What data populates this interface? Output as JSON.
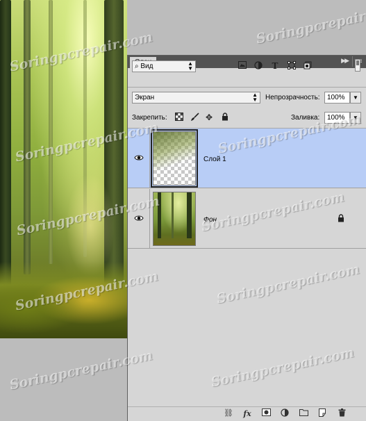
{
  "watermark": "Soringpcrepair.com",
  "panel": {
    "tab_label": "Слои",
    "collapse_icon": "double-chevron-right-icon",
    "menu_icon": "panel-menu-icon"
  },
  "filter": {
    "kind_label": "Вид",
    "icons": [
      "image-filter-icon",
      "adjustment-filter-icon",
      "type-filter-icon",
      "shape-filter-icon",
      "smart-object-filter-icon"
    ]
  },
  "blend": {
    "mode": "Экран",
    "opacity_label": "Непрозрачность:",
    "opacity_value": "100%",
    "lock_label": "Закрепить:",
    "fill_label": "Заливка:",
    "fill_value": "100%"
  },
  "layers": [
    {
      "name": "Слой 1",
      "visible": true,
      "selected": true,
      "locked": false
    },
    {
      "name": "Фон",
      "visible": true,
      "selected": false,
      "locked": true
    }
  ],
  "bottom_icons": [
    "link-layers-icon",
    "fx-icon",
    "add-mask-icon",
    "adjustment-layer-icon",
    "group-folder-icon",
    "new-layer-icon",
    "trash-icon"
  ],
  "glyphs": {
    "eye": "👁",
    "lock": "🔒",
    "fx": "fx",
    "search": "⌕",
    "type": "T",
    "move": "✥",
    "brush": "🖌"
  }
}
